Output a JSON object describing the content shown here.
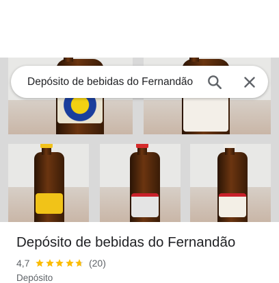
{
  "search": {
    "query": "Depósito de bebidas do Fernandão",
    "search_icon": "search-icon",
    "close_icon": "close-icon"
  },
  "photos": [
    {
      "name": "beer-bottle-photo"
    },
    {
      "name": "itaipava-bottle-photo"
    },
    {
      "name": "skol-bottle-photo"
    },
    {
      "name": "brahma-bottle-photo"
    },
    {
      "name": "antarctica-bottle-photo"
    }
  ],
  "place": {
    "title": "Depósito de bebidas do Fernandão",
    "rating": "4,7",
    "stars": 4.7,
    "reviews": "(20)",
    "category": "Depósito"
  },
  "colors": {
    "star": "#fbbc04",
    "star_empty": "#dadce0",
    "text_primary": "#202124",
    "text_secondary": "#5f6368"
  }
}
